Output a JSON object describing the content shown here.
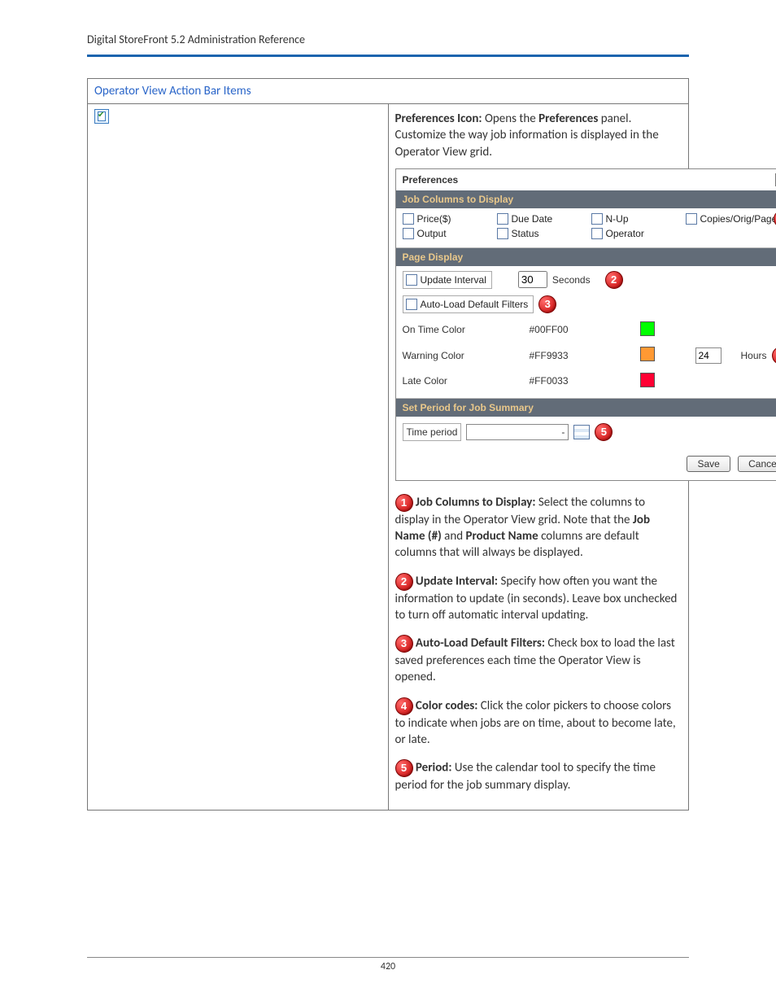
{
  "header": {
    "doc_title": "Digital StoreFront 5.2 Administration Reference"
  },
  "table_heading": "Operator View Action Bar Items",
  "intro": {
    "lead_bold": "Preferences Icon:",
    "lead_rest_a": " Opens the ",
    "lead_bold2": "Preferences",
    "lead_rest_b": " panel. Customize the way job information is displayed in the Operator View grid."
  },
  "panel": {
    "title": "Preferences",
    "close_glyph": "✕",
    "sections": {
      "columns": {
        "header": "Job Columns to Display",
        "items": [
          "Price($)",
          "Due Date",
          "N-Up",
          "Copies/Orig/Pages",
          "Output",
          "Status",
          "Operator"
        ]
      },
      "page_display": {
        "header": "Page Display",
        "update_interval_label": "Update Interval",
        "update_interval_value": "30",
        "update_interval_unit": "Seconds",
        "autoload_label": "Auto-Load Default Filters",
        "rows": [
          {
            "label": "On Time Color",
            "value": "#00FF00",
            "swatch": "#00FF00",
            "extra_value": "",
            "extra_unit": ""
          },
          {
            "label": "Warning Color",
            "value": "#FF9933",
            "swatch": "#FF9933",
            "extra_value": "24",
            "extra_unit": "Hours"
          },
          {
            "label": "Late Color",
            "value": "#FF0033",
            "swatch": "#FF0033",
            "extra_value": "",
            "extra_unit": ""
          }
        ]
      },
      "period": {
        "header": "Set Period for Job Summary",
        "label": "Time period",
        "field_value": "-"
      }
    },
    "buttons": {
      "save": "Save",
      "cancel": "Cancel"
    },
    "callouts": {
      "c1": "1",
      "c2": "2",
      "c3": "3",
      "c4": "4",
      "c5": "5"
    }
  },
  "descriptions": {
    "d1": {
      "title": "Job Columns to Display:",
      "body_a": " Select the columns to display in the Operator View grid. Note that the ",
      "bold_a": "Job Name (#)",
      "mid": " and ",
      "bold_b": "Product Name",
      "body_b": " columns are default columns that will always be displayed."
    },
    "d2": {
      "title": "Update Interval:",
      "body": " Specify how often you want the information to update (in seconds). Leave box unchecked to turn off automatic interval updating."
    },
    "d3": {
      "title": "Auto-Load Default Filters:",
      "body": " Check box to load the last saved preferences each time the Operator View is opened."
    },
    "d4": {
      "title": "Color codes:",
      "body": " Click the color pickers to choose colors to indicate when jobs are on time, about to become late, or late."
    },
    "d5": {
      "title": "Period:",
      "body": " Use the calendar tool to specify the time period for the job summary display."
    }
  },
  "page_number": "420"
}
